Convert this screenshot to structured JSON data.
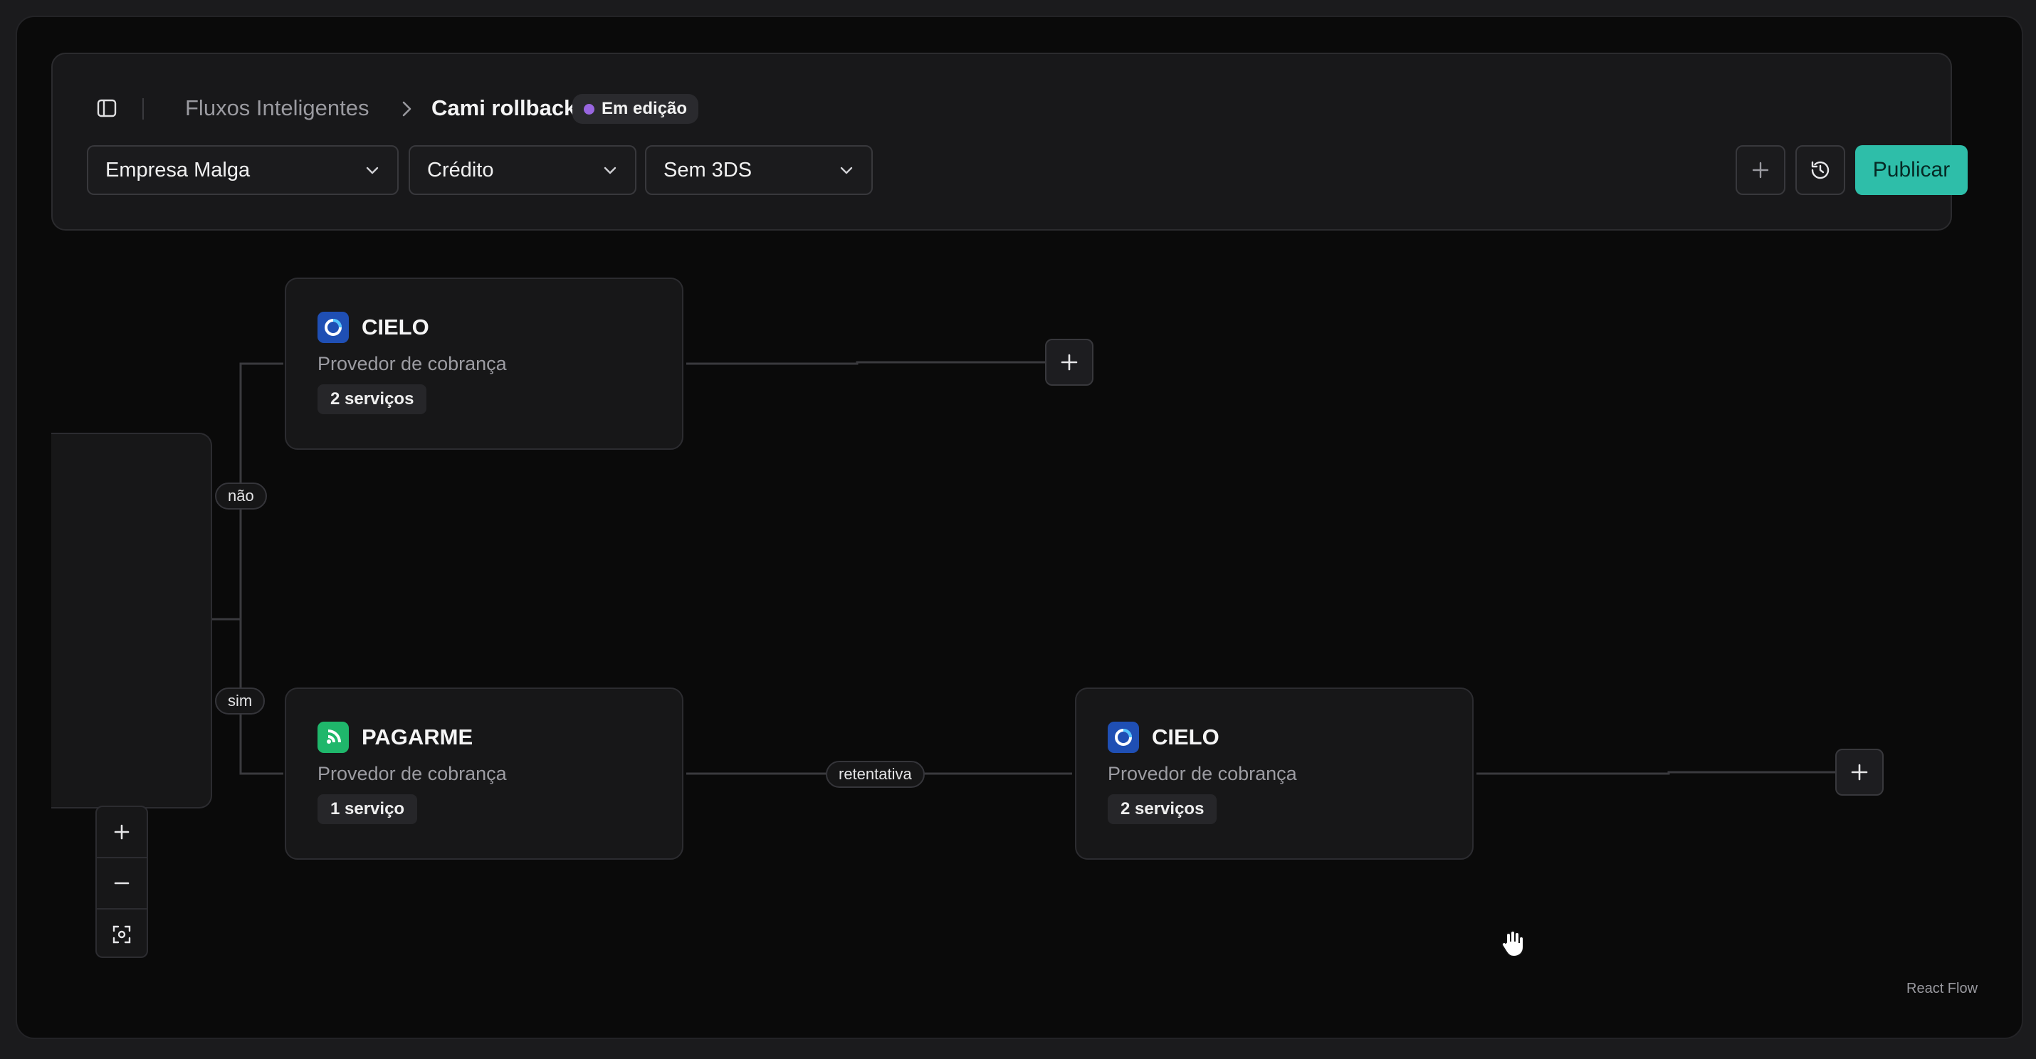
{
  "header": {
    "breadcrumb_root": "Fluxos Inteligentes",
    "breadcrumb_current": "Cami rollback",
    "status_badge": "Em edição",
    "filters": {
      "company": "Empresa Malga",
      "payment_method": "Crédito",
      "three_ds": "Sem 3DS"
    },
    "publish_label": "Publicar"
  },
  "flow": {
    "branch_no_label": "não",
    "branch_yes_label": "sim",
    "retry_label": "retentativa",
    "nodes": [
      {
        "title": "CIELO",
        "subtitle": "Provedor de cobrança",
        "chip": "2 serviços",
        "logo": "cielo-logo-icon"
      },
      {
        "title": "PAGARME",
        "subtitle": "Provedor de cobrança",
        "chip": "1 serviço",
        "logo": "pagarme-logo-icon"
      },
      {
        "title": "CIELO",
        "subtitle": "Provedor de cobrança",
        "chip": "2 serviços",
        "logo": "cielo-logo-icon"
      }
    ]
  },
  "attribution": "React Flow",
  "colors": {
    "accent": "#2ebea9",
    "status_dot": "#9966e0",
    "cielo_logo": "#1f4fb4",
    "pagarme_logo": "#1fb76b"
  }
}
